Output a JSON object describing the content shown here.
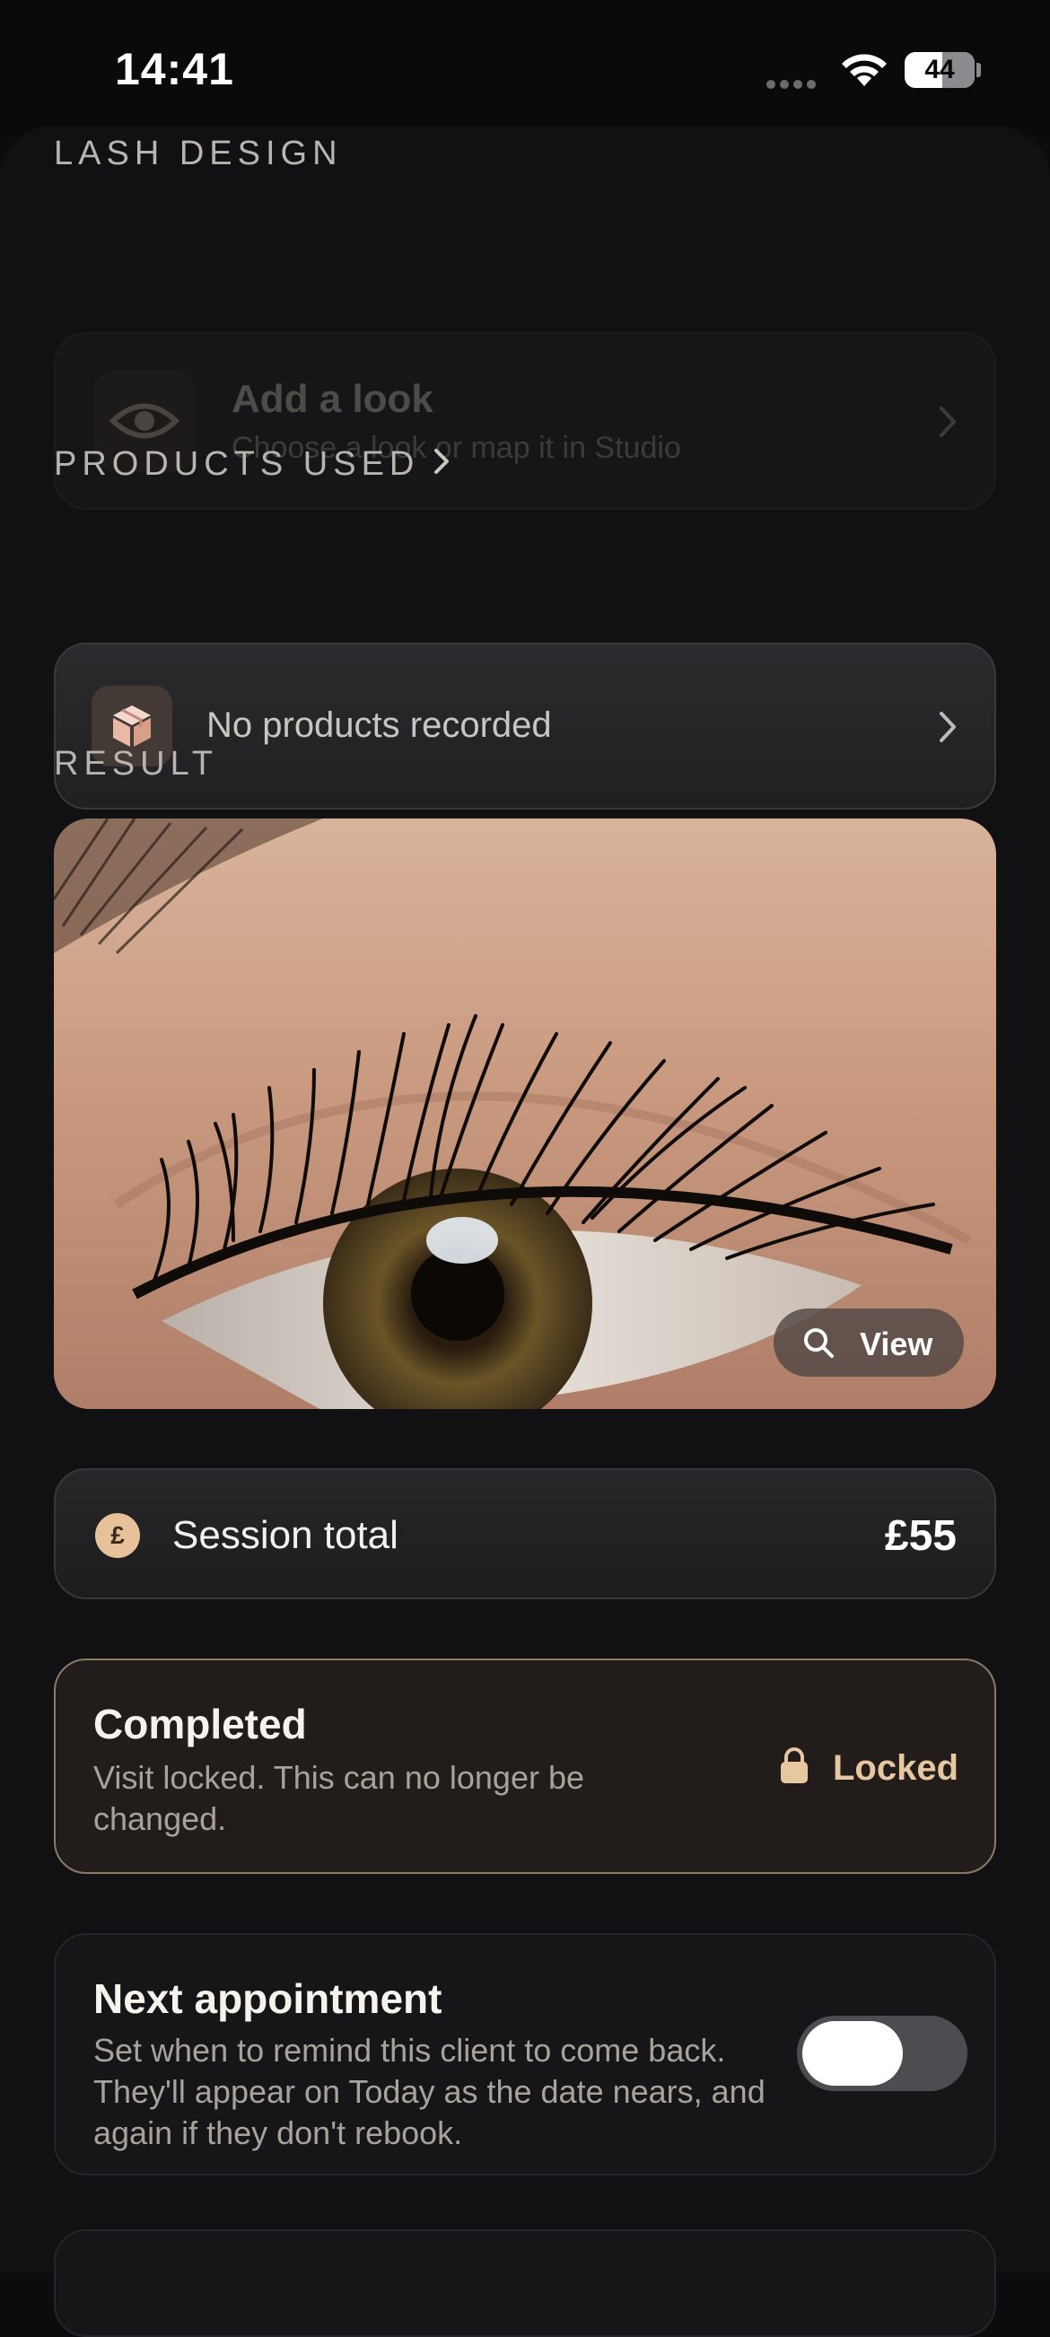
{
  "status_bar": {
    "time": "14:41",
    "battery": "44"
  },
  "lash_design": {
    "section_label": "LASH DESIGN",
    "title": "Add a look",
    "subtitle": "Choose a look or map it in Studio"
  },
  "products": {
    "section_label": "PRODUCTS USED",
    "empty_text": "No products recorded"
  },
  "result": {
    "section_label": "RESULT",
    "view_label": "View"
  },
  "session": {
    "currency_symbol": "£",
    "label": "Session total",
    "value": "£55"
  },
  "completed": {
    "title": "Completed",
    "subtitle": "Visit locked. This can no longer be changed.",
    "locked_label": "Locked"
  },
  "next_appointment": {
    "title": "Next appointment",
    "subtitle": "Set when to remind this client to come back. They'll appear on Today as the date nears, and again if they don't rebook.",
    "toggle_on": false
  },
  "colors": {
    "background": "#111113",
    "accent": "#e6c7a0",
    "completed_border": "#8a7b66"
  }
}
